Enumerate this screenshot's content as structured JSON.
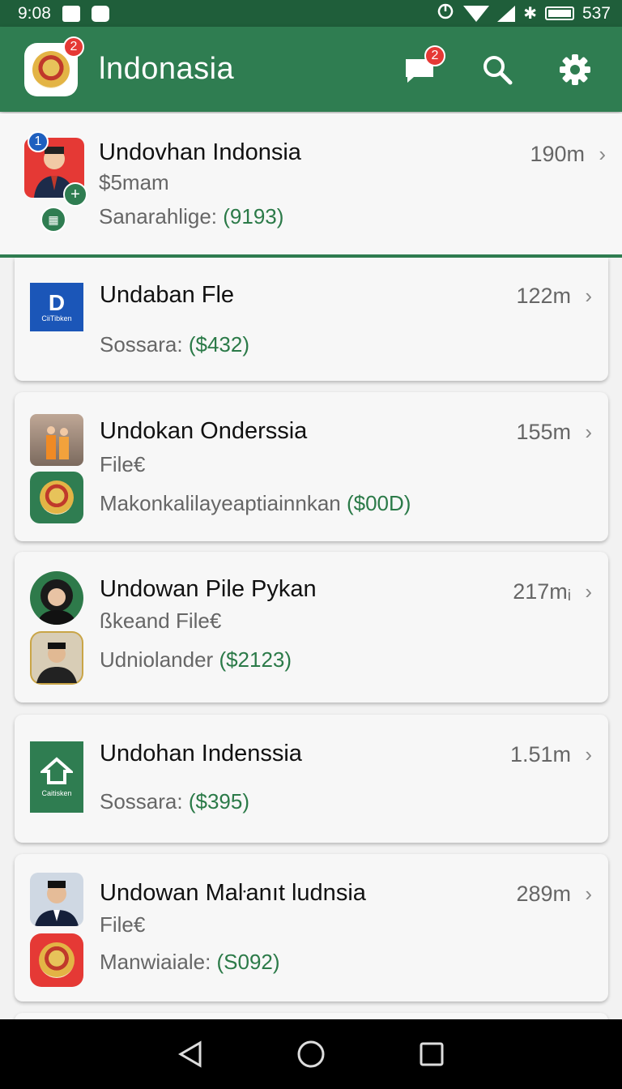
{
  "status_bar": {
    "time": "9:08",
    "battery_level": "537"
  },
  "app_bar": {
    "title": "lndonasia",
    "logo_badge": "2",
    "messages_badge": "2",
    "icons": [
      "flag-emblem-icon",
      "message-icon",
      "search-icon",
      "gear-icon"
    ]
  },
  "items": [
    {
      "title": "Undovhan Indonsia",
      "subtitle": "$5mam",
      "line3_label": "Sanarahlige: ",
      "line3_price": "(9193)",
      "distance": "190m",
      "badge": "1"
    },
    {
      "title": "Undaban Fle",
      "subtitle": "",
      "line3_label": "Sossara: ",
      "line3_price": "($432)",
      "distance": "122m",
      "logo_caption": "CiiTibken"
    },
    {
      "title": "Undokan Onderssia",
      "subtitle": "File€",
      "line3_label": "Makonkalilayeaptiainnkan ",
      "line3_price": "($00D)",
      "distance": "155m"
    },
    {
      "title": "Undowan Pile Pykan",
      "subtitle": "ßkeand File€",
      "line3_label": "Udniolander  ",
      "line3_price": "($2123)",
      "distance": "217mᵢ"
    },
    {
      "title": "Undohan Indenssia",
      "subtitle": "",
      "line3_label": "Sossara: ",
      "line3_price": "($395)",
      "distance": "1.51m",
      "logo_caption": "Caitisken"
    },
    {
      "title": "Undowan Maŀanıt ludnsia",
      "subtitle": "File€",
      "line3_label": "Manwiaiale: ",
      "line3_price": "(S092)",
      "distance": "289m"
    }
  ],
  "colors": {
    "primary": "#2f7d51",
    "status_bar": "#1f5e3a",
    "price": "#2b7a48",
    "badge": "#e53935"
  }
}
